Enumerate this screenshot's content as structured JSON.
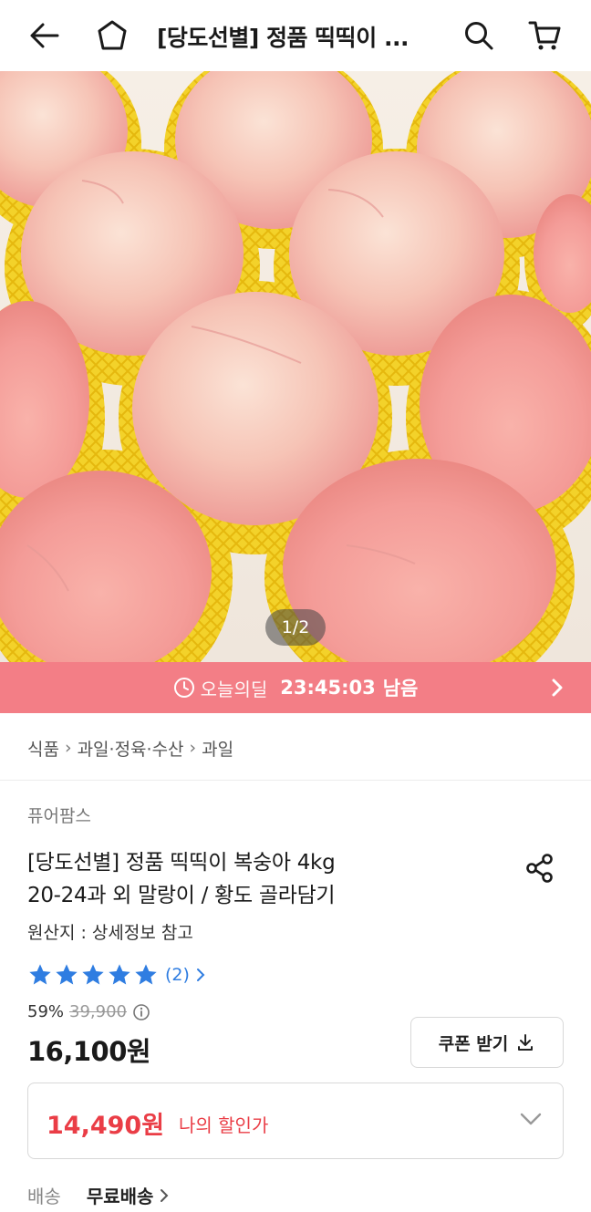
{
  "header": {
    "title": "[당도선별] 정품 띡띡이 ...",
    "icons": [
      "back-arrow-icon",
      "home-icon",
      "search-icon",
      "cart-icon"
    ]
  },
  "hero": {
    "pager": "1/2"
  },
  "deal": {
    "label": "오늘의딜",
    "time": "23:45:03",
    "suffix": "남음"
  },
  "breadcrumb": [
    "식품",
    "과일·정육·수산",
    "과일"
  ],
  "product": {
    "seller": "퓨어팜스",
    "title_line1": "[당도선별] 정품 띡띡이 복숭아 4kg",
    "title_line2": "20-24과 외 말랑이 / 황도 골라담기",
    "origin": "원산지 : 상세정보 참고",
    "rating_stars": 5,
    "review_count": "(2)",
    "discount_pct": "59%",
    "original_price": "39,900",
    "price": "16,100원"
  },
  "coupon": {
    "label": "쿠폰 받기"
  },
  "my_price": {
    "price": "14,490원",
    "label": "나의 할인가"
  },
  "shipping": {
    "label": "배송",
    "value": "무료배송"
  },
  "colors": {
    "deal_bar": "#f37e86",
    "accent_red": "#ea3d46",
    "star_blue": "#2f7de1"
  }
}
